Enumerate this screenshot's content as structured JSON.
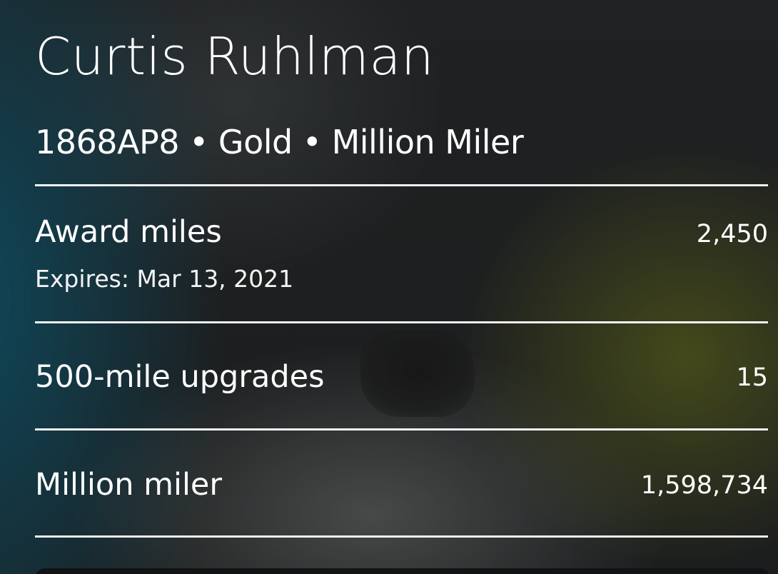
{
  "member": {
    "name": "Curtis Ruhlman",
    "status_line": "1868AP8 • Gold • Million Miler"
  },
  "rows": [
    {
      "label": "Award miles",
      "sub": "Expires: Mar 13, 2021",
      "value": "2,450"
    },
    {
      "label": "500-mile upgrades",
      "value": "15"
    },
    {
      "label": "Million miler",
      "value": "1,598,734"
    }
  ],
  "colors": {
    "text": "#ffffff",
    "divider": "#f2f2f2",
    "background": "#1c1e1f",
    "teal_glow": "#0c4e64",
    "olive_glow": "#646c16"
  }
}
